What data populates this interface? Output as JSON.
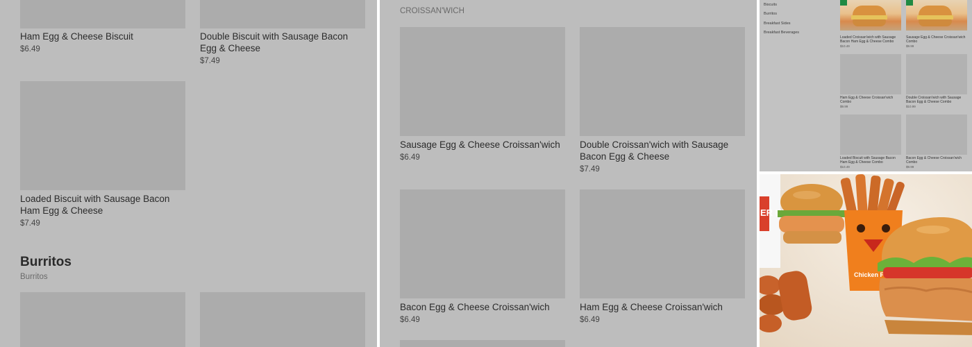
{
  "panel1": {
    "items": [
      {
        "name": "Ham Egg & Cheese Biscuit",
        "price": "$6.49"
      },
      {
        "name": "Double Biscuit with Sausage Bacon Egg & Cheese",
        "price": "$7.49"
      },
      {
        "name": "Loaded Biscuit with Sausage Bacon Ham Egg & Cheese",
        "price": "$7.49"
      }
    ],
    "section": {
      "title": "Burritos",
      "subtitle": "Burritos"
    }
  },
  "panel2": {
    "section_subtitle": "CROISSAN'WICH",
    "items": [
      {
        "name": "Sausage Egg & Cheese Croissan'wich",
        "price": "$6.49"
      },
      {
        "name": "Double Croissan'wich with Sausage Bacon Egg & Cheese",
        "price": "$7.49"
      },
      {
        "name": "Bacon Egg & Cheese Croissan'wich",
        "price": "$6.49"
      },
      {
        "name": "Ham Egg & Cheese Croissan'wich",
        "price": "$6.49"
      }
    ]
  },
  "panel3": {
    "sidebar": [
      "Biscuits",
      "Burritos",
      "Breakfast Sides",
      "Breakfast Beverages"
    ],
    "items": [
      {
        "name": "Loaded Croissan'wich with Sausage Bacon Ham Egg & Cheese Combo",
        "price": "$10.49"
      },
      {
        "name": "Sausage Egg & Cheese Croissan'wich Combo",
        "price": "$9.99"
      },
      {
        "name": "Ham Egg & Cheese Croissan'wich Combo",
        "price": "$9.99"
      },
      {
        "name": "Double Croissan'wich with Sausage Bacon Egg & Cheese Combo",
        "price": "$10.99"
      },
      {
        "name": "Loaded Biscuit with Sausage Bacon Ham Egg & Cheese Combo",
        "price": "$10.49"
      },
      {
        "name": "Bacon Egg & Cheese Croissan'wich Combo",
        "price": "$9.99"
      }
    ]
  },
  "panel4": {
    "fries_box_text": "Chicken Fries",
    "cup_text": "ER KING"
  },
  "colors": {
    "panel_bg": "#bdbdbd",
    "placeholder": "#acacac",
    "fries_box": "#f07f1d"
  }
}
